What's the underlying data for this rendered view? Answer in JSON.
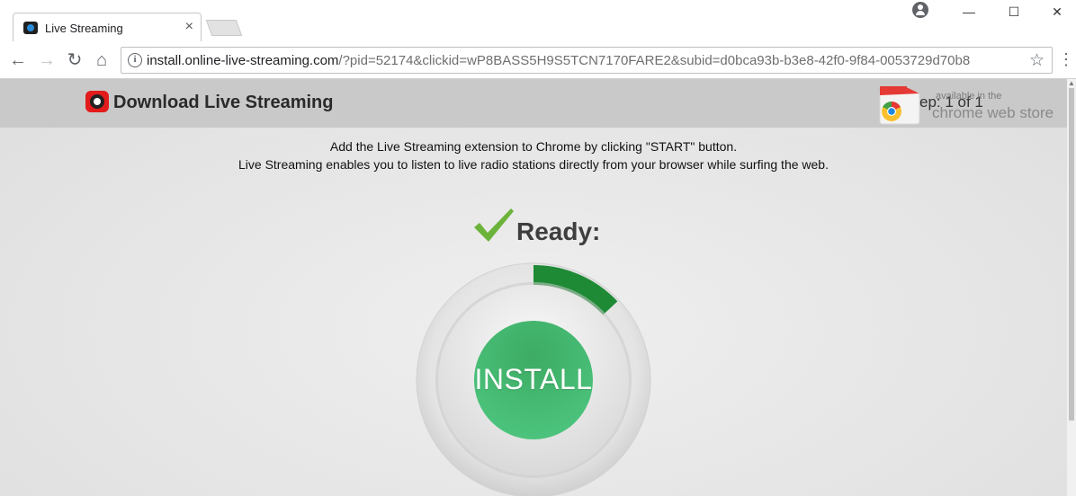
{
  "browser": {
    "tab_title": "Live Streaming",
    "tab_close": "×",
    "url_host": "install.online-live-streaming.com",
    "url_rest": "/?pid=52174&clickid=wP8BASS5H9S5TCN7170FARE2&subid=d0bca93b-b3e8-42f0-9f84-0053729d70b8",
    "back": "←",
    "forward": "→",
    "reload": "↻",
    "home": "⌂",
    "info": "i",
    "star": "☆",
    "menu": "⋮",
    "minimize": "—",
    "maximize": "☐",
    "close": "✕",
    "icons": [
      "tab-favicon",
      "profile-icon",
      "info-icon",
      "star-icon",
      "menu-icon"
    ]
  },
  "header": {
    "title": "Download Live Streaming",
    "step": "ep: 1 of 1",
    "cws_small": "available in the",
    "cws_big": "chrome web store",
    "colors": {
      "header_bg": "#c9c9c9",
      "logo_red": "#e21b1b"
    }
  },
  "main": {
    "line1": "Add the Live Streaming extension to Chrome by clicking \"START\" button.",
    "line2": "Live Streaming enables you to listen to live radio stations directly from your browser while surfing the web.",
    "ready": "Ready:",
    "install_label": "INSTALL",
    "progress_fraction": 0.13,
    "bottom_line": "",
    "colors": {
      "progress": "#1e8a35",
      "button_green": "#3fb26a",
      "check_green": "#6bb33a"
    }
  }
}
